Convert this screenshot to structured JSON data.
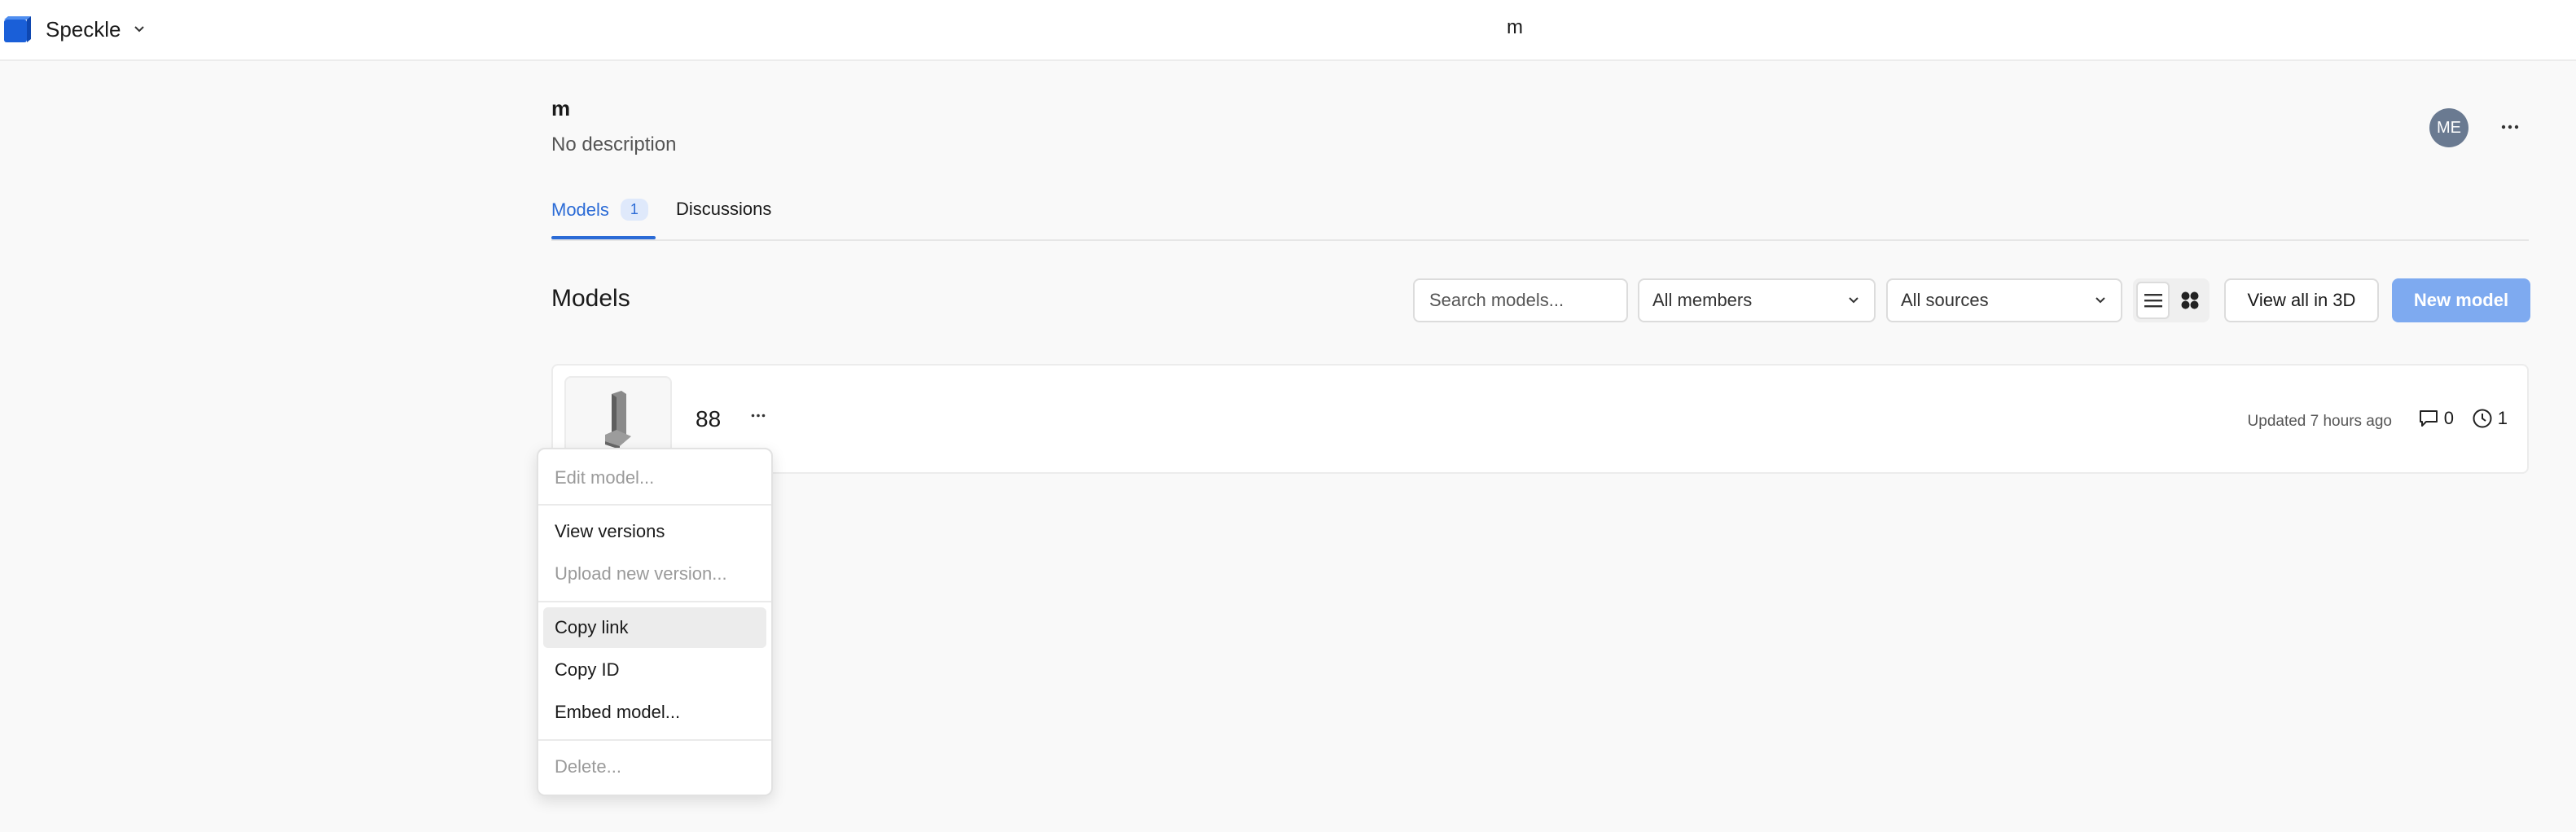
{
  "topbar": {
    "brand_name": "Speckle",
    "title": "m"
  },
  "project": {
    "title": "m",
    "description": "No description",
    "avatar_initials": "ME"
  },
  "tabs": {
    "models_label": "Models",
    "models_count": "1",
    "discussions_label": "Discussions"
  },
  "models_section": {
    "title": "Models",
    "search_placeholder": "Search models...",
    "members_filter": "All members",
    "sources_filter": "All sources",
    "view_all_3d_label": "View all in 3D",
    "new_model_label": "New model"
  },
  "model_card": {
    "name": "88",
    "updated": "Updated 7 hours ago",
    "comments_count": "0",
    "versions_count": "1"
  },
  "context_menu": {
    "edit": "Edit model...",
    "view_versions": "View versions",
    "upload": "Upload new version...",
    "copy_link": "Copy link",
    "copy_id": "Copy ID",
    "embed": "Embed model...",
    "delete": "Delete..."
  },
  "colors": {
    "accent": "#2b6bd6",
    "primary_button": "#7eaaf0",
    "avatar": "#6a7a91"
  }
}
